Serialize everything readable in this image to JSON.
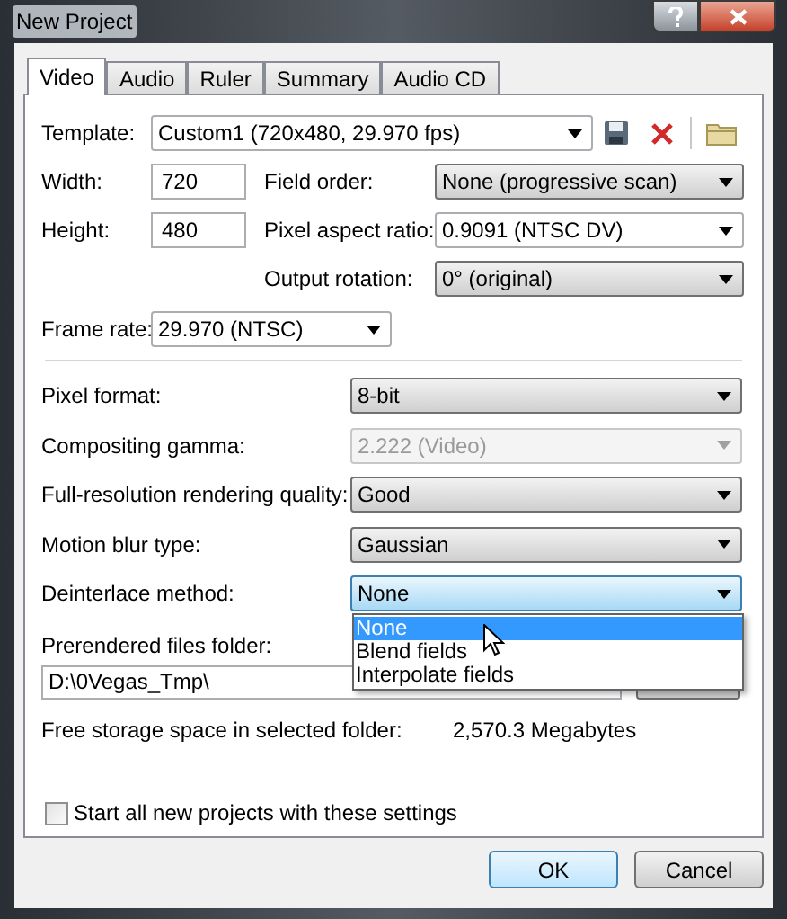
{
  "window": {
    "title": "New Project"
  },
  "tabs": [
    {
      "label": "Video",
      "selected": true
    },
    {
      "label": "Audio",
      "selected": false
    },
    {
      "label": "Ruler",
      "selected": false
    },
    {
      "label": "Summary",
      "selected": false
    },
    {
      "label": "Audio CD",
      "selected": false
    }
  ],
  "template": {
    "label": "Template:",
    "value": "Custom1 (720x480, 29.970 fps)"
  },
  "size_fields": [
    {
      "label": "Width:",
      "value": "720"
    },
    {
      "label": "Height:",
      "value": "480"
    }
  ],
  "right_selects": [
    {
      "label": "Field order:",
      "value": "None (progressive scan)"
    },
    {
      "label": "Pixel aspect ratio:",
      "value": "0.9091 (NTSC DV)"
    },
    {
      "label": "Output rotation:",
      "value": "0° (original)"
    }
  ],
  "frame_rate": {
    "label": "Frame rate:",
    "value": "29.970 (NTSC)"
  },
  "settings": [
    {
      "label": "Pixel format:",
      "value": "8-bit",
      "disabled": false,
      "expanded": false
    },
    {
      "label": "Compositing gamma:",
      "value": "2.222 (Video)",
      "disabled": true,
      "expanded": false
    },
    {
      "label": "Full-resolution rendering quality:",
      "value": "Good",
      "disabled": false,
      "expanded": false
    },
    {
      "label": "Motion blur type:",
      "value": "Gaussian",
      "disabled": false,
      "expanded": false
    },
    {
      "label": "Deinterlace method:",
      "value": "None",
      "disabled": false,
      "expanded": true
    }
  ],
  "dropdown_options": [
    {
      "label": "None",
      "selected": true
    },
    {
      "label": "Blend fields",
      "selected": false
    },
    {
      "label": "Interpolate fields",
      "selected": false
    }
  ],
  "prerendered": {
    "label": "Prerendered files folder:",
    "path": "D:\\0Vegas_Tmp\\"
  },
  "free_storage": {
    "label": "Free storage space in selected folder:",
    "value": "2,570.3 Megabytes"
  },
  "start_checkbox": {
    "label": "Start all new projects with these settings",
    "checked": false
  },
  "buttons": [
    {
      "label": "OK",
      "default": true
    },
    {
      "label": "Cancel",
      "default": false
    }
  ]
}
